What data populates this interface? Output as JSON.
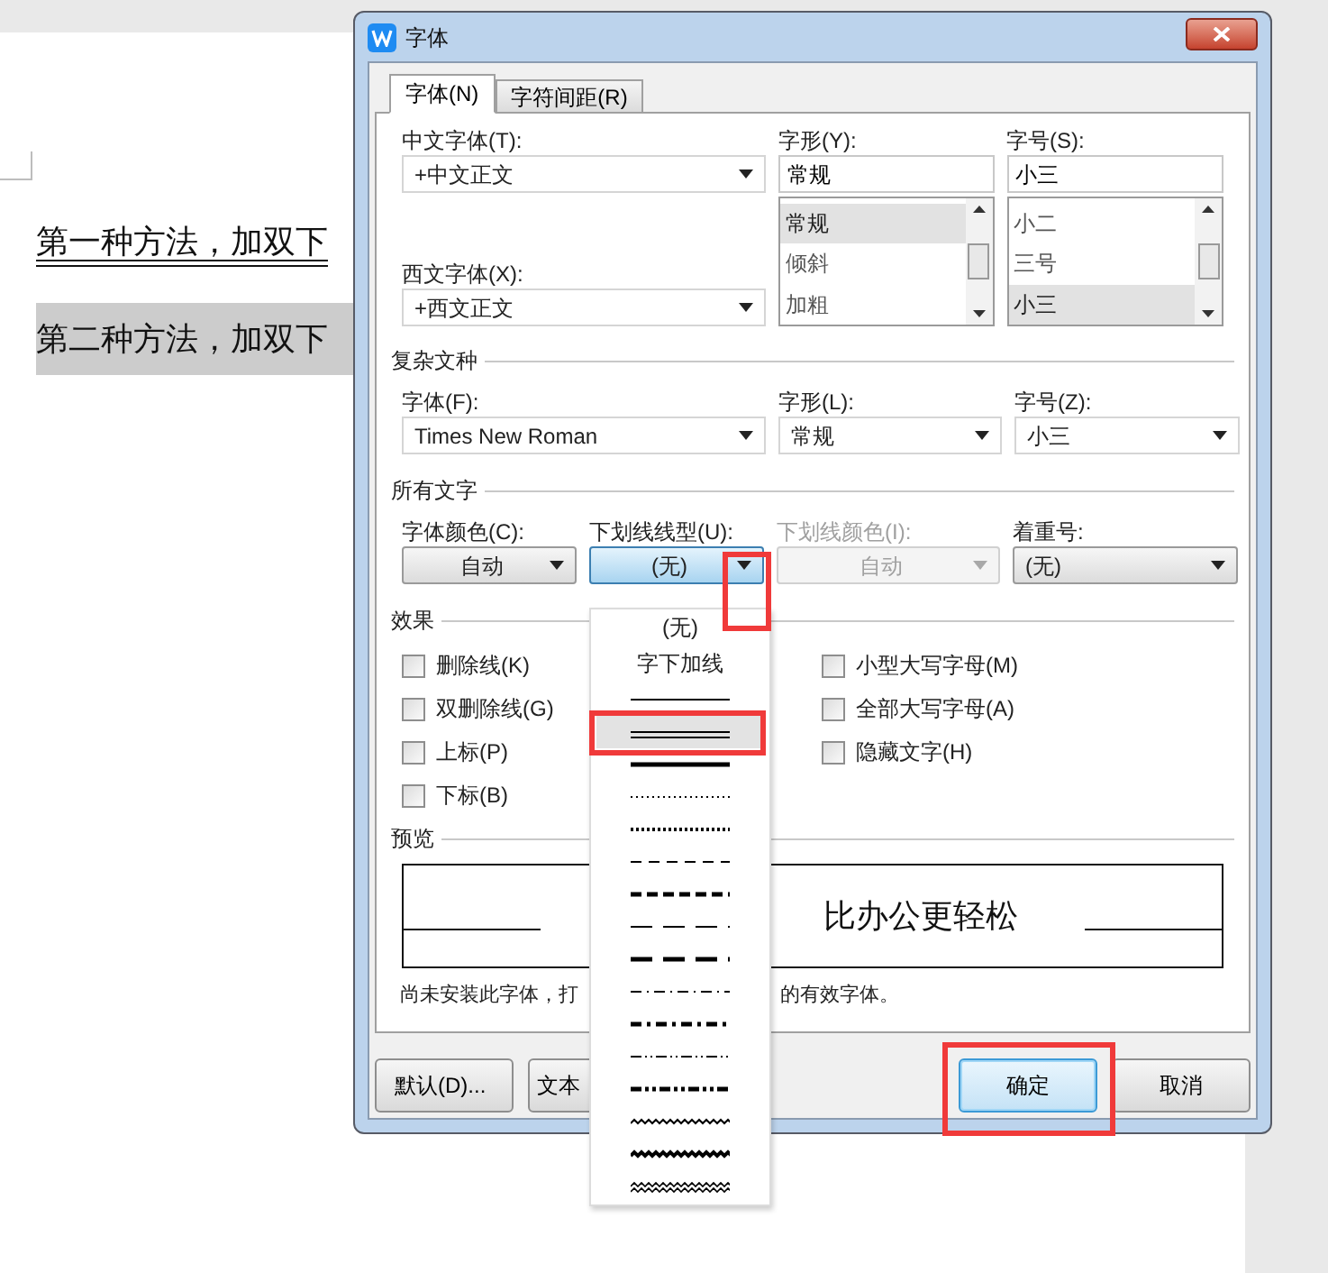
{
  "document": {
    "lines": [
      {
        "text": "第一种方法，加双下",
        "underlined": true,
        "highlighted": false
      },
      {
        "text": "第二种方法，加双下",
        "underlined": false,
        "highlighted": true
      }
    ]
  },
  "dialog": {
    "title": "字体",
    "tabs": [
      {
        "label": "字体(N)",
        "selected": true
      },
      {
        "label": "字符间距(R)",
        "selected": false
      }
    ],
    "chinese_font": {
      "label": "中文字体(T):",
      "value": "+中文正文"
    },
    "western_font": {
      "label": "西文字体(X):",
      "value": "+西文正文"
    },
    "style": {
      "label": "字形(Y):",
      "value": "常规",
      "options": [
        {
          "label": "常规",
          "selected": true
        },
        {
          "label": "倾斜",
          "selected": false
        },
        {
          "label": "加粗",
          "selected": false
        }
      ]
    },
    "size": {
      "label": "字号(S):",
      "value": "小三",
      "options": [
        {
          "label": "小二",
          "selected": false
        },
        {
          "label": "三号",
          "selected": false
        },
        {
          "label": "小三",
          "selected": true
        }
      ]
    },
    "complex": {
      "title": "复杂文种",
      "fields": [
        {
          "label": "字体(F):",
          "value": "Times New Roman"
        },
        {
          "label": "字形(L):",
          "value": "常规"
        },
        {
          "label": "字号(Z):",
          "value": "小三"
        }
      ]
    },
    "all_text": {
      "title": "所有文字",
      "fields": [
        {
          "label": "字体颜色(C):",
          "value": "自动",
          "disabled": false,
          "active": false
        },
        {
          "label": "下划线线型(U):",
          "value": "(无)",
          "disabled": false,
          "active": true
        },
        {
          "label": "下划线颜色(I):",
          "value": "自动",
          "disabled": true,
          "active": false
        },
        {
          "label": "着重号:",
          "value": "(无)",
          "disabled": false,
          "active": false
        }
      ]
    },
    "effects": {
      "title": "效果",
      "left": [
        {
          "label": "删除线(K)",
          "checked": false
        },
        {
          "label": "双删除线(G)",
          "checked": false
        },
        {
          "label": "上标(P)",
          "checked": false
        },
        {
          "label": "下标(B)",
          "checked": false
        }
      ],
      "right": [
        {
          "label": "小型大写字母(M)",
          "checked": false
        },
        {
          "label": "全部大写字母(A)",
          "checked": false
        },
        {
          "label": "隐藏文字(H)",
          "checked": false
        }
      ]
    },
    "preview": {
      "title": "预览",
      "sample": "比办公更轻松",
      "note_start": "尚未安装此字体，打",
      "note_end": "的有效字体。"
    },
    "buttons": [
      {
        "label": "默认(D)...",
        "primary": false
      },
      {
        "label": "文本",
        "primary": false
      },
      {
        "label": "确定",
        "primary": true
      },
      {
        "label": "取消",
        "primary": false
      }
    ]
  },
  "underline_menu": {
    "items": [
      {
        "kind": "text",
        "label": "(无)",
        "selected": false
      },
      {
        "kind": "text",
        "label": "字下加线",
        "selected": false
      },
      {
        "kind": "single",
        "selected": false
      },
      {
        "kind": "double",
        "selected": true
      },
      {
        "kind": "thick",
        "selected": false
      },
      {
        "kind": "dotted",
        "selected": false
      },
      {
        "kind": "dotted_heavy",
        "selected": false
      },
      {
        "kind": "dash",
        "selected": false
      },
      {
        "kind": "dash_heavy",
        "selected": false
      },
      {
        "kind": "long_dash",
        "selected": false
      },
      {
        "kind": "long_dash_heavy",
        "selected": false
      },
      {
        "kind": "dash_dot",
        "selected": false
      },
      {
        "kind": "dash_dot_heavy",
        "selected": false
      },
      {
        "kind": "dash_dot_dot",
        "selected": false
      },
      {
        "kind": "dash_dot_dot_heavy",
        "selected": false
      },
      {
        "kind": "wave",
        "selected": false
      },
      {
        "kind": "wave_heavy",
        "selected": false
      },
      {
        "kind": "wave_double",
        "selected": false
      }
    ]
  }
}
